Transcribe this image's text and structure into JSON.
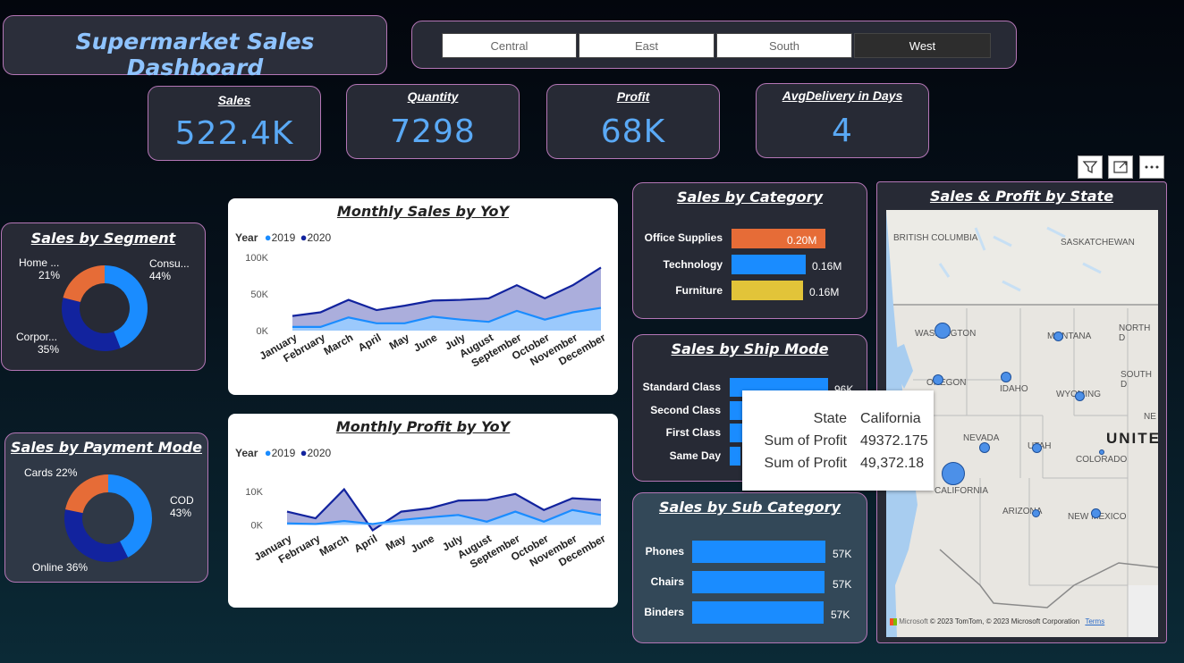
{
  "title": "Supermarket Sales Dashboard",
  "regions": {
    "items": [
      "Central",
      "East",
      "South",
      "West"
    ],
    "selected": "West"
  },
  "kpis": [
    {
      "label": "Sales",
      "value": "522.4K"
    },
    {
      "label": "Quantity",
      "value": "7298"
    },
    {
      "label": "Profit",
      "value": "68K"
    },
    {
      "label": "AvgDelivery in Days",
      "value": "4"
    }
  ],
  "segment": {
    "title": "Sales by Segment",
    "slices": [
      {
        "name": "Consu...",
        "pct": "44%",
        "value": 44,
        "color": "#1a8cff"
      },
      {
        "name": "Corpor...",
        "pct": "35%",
        "value": 35,
        "color": "#12239e"
      },
      {
        "name": "Home ...",
        "pct": "21%",
        "value": 21,
        "color": "#e66c37"
      }
    ]
  },
  "payment": {
    "title": "Sales by Payment Mode",
    "slices": [
      {
        "name": "COD",
        "pct": "43%",
        "value": 43,
        "color": "#1a8cff"
      },
      {
        "name": "Online",
        "pct": "36%",
        "value": 36,
        "color": "#12239e"
      },
      {
        "name": "Cards",
        "pct": "22%",
        "value": 22,
        "color": "#e66c37"
      }
    ]
  },
  "chart_data": [
    {
      "type": "area",
      "title": "Monthly Sales by YoY",
      "legend_title": "Year",
      "categories": [
        "January",
        "February",
        "March",
        "April",
        "May",
        "June",
        "July",
        "August",
        "September",
        "October",
        "November",
        "December"
      ],
      "yticks": [
        "100K",
        "50K",
        "0K"
      ],
      "ylim": [
        0,
        100000
      ],
      "series": [
        {
          "name": "2019",
          "color": "#1a8cff",
          "values": [
            5000,
            5000,
            18000,
            10000,
            10000,
            19000,
            15000,
            12000,
            27000,
            15000,
            25000,
            31000
          ]
        },
        {
          "name": "2020",
          "color": "#12239e",
          "values": [
            20000,
            25000,
            42000,
            28000,
            34000,
            41000,
            42000,
            44000,
            62000,
            44000,
            62000,
            86000
          ]
        }
      ]
    },
    {
      "type": "area",
      "title": "Monthly Profit by YoY",
      "legend_title": "Year",
      "categories": [
        "January",
        "February",
        "March",
        "April",
        "May",
        "June",
        "July",
        "August",
        "September",
        "October",
        "November",
        "December"
      ],
      "yticks": [
        "10K",
        "0K"
      ],
      "ylim": [
        -2000,
        13000
      ],
      "series": [
        {
          "name": "2019",
          "color": "#1a8cff",
          "values": [
            500,
            300,
            1200,
            300,
            1500,
            2300,
            3000,
            1000,
            4000,
            1000,
            4500,
            3000
          ]
        },
        {
          "name": "2020",
          "color": "#12239e",
          "values": [
            4000,
            2000,
            10700,
            -1600,
            4000,
            5000,
            7300,
            7500,
            9300,
            4500,
            8000,
            7500
          ]
        }
      ]
    },
    {
      "type": "bar",
      "title": "Sales by Category",
      "categories": [
        "Office Supplies",
        "Technology",
        "Furniture"
      ],
      "values": [
        0.2,
        0.16,
        0.16
      ],
      "value_labels": [
        "0.20M",
        "0.16M",
        "0.16M"
      ],
      "colors": [
        "#e66c37",
        "#1a8cff",
        "#e2c439"
      ]
    },
    {
      "type": "bar",
      "title": "Sales by Ship Mode",
      "categories": [
        "Standard Class",
        "Second Class",
        "First Class",
        "Same Day"
      ],
      "values": [
        96,
        0,
        0,
        0
      ],
      "value_labels": [
        "96K",
        "",
        "",
        ""
      ],
      "colors": [
        "#1a8cff"
      ]
    },
    {
      "type": "bar",
      "title": "Sales by Sub Category",
      "categories": [
        "Phones",
        "Chairs",
        "Binders"
      ],
      "values": [
        57,
        57,
        57
      ],
      "value_labels": [
        "57K",
        "57K",
        "57K"
      ],
      "colors": [
        "#1a8cff"
      ]
    }
  ],
  "tooltip": {
    "rows": [
      {
        "k": "State",
        "v": "California"
      },
      {
        "k": "Sum of Profit",
        "v": "49372.175"
      },
      {
        "k": "Sum of Profit",
        "v": "49,372.18"
      }
    ]
  },
  "map": {
    "title": "Sales & Profit by State",
    "labels": [
      "BRITISH COLUMBIA",
      "SASKATCHEWAN",
      "WASHINGTON",
      "MONTANA",
      "NORTH D",
      "OREGON",
      "IDAHO",
      "WYOMING",
      "SOUTH D",
      "NE",
      "NEVADA",
      "UTAH",
      "COLORADO",
      "UNITE",
      "CALIFORNIA",
      "ARIZONA",
      "NEW MEXICO"
    ],
    "attribution": "© 2023 TomTom, © 2023 Microsoft Corporation",
    "terms": "Terms",
    "ms": "Microsoft"
  },
  "icons": [
    "filter-icon",
    "focus-mode-icon",
    "more-options-icon"
  ]
}
